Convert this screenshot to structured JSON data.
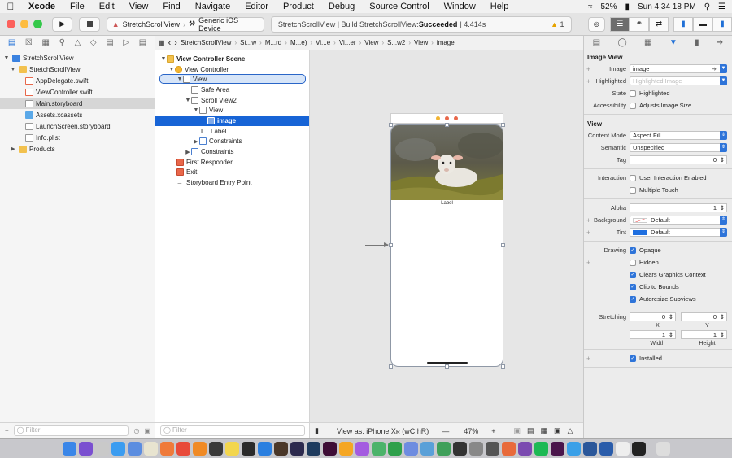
{
  "menubar": {
    "app": "Xcode",
    "items": [
      "File",
      "Edit",
      "View",
      "Find",
      "Navigate",
      "Editor",
      "Product",
      "Debug",
      "Source Control",
      "Window",
      "Help"
    ],
    "battery": "52%",
    "clock": "Sun 4 34 18 PM"
  },
  "toolbar": {
    "scheme": "StretchScrollView",
    "device": "Generic iOS Device",
    "status_prefix": "StretchScrollView | Build StretchScrollView: ",
    "status_result": "Succeeded",
    "status_time": "| 4.414s",
    "warnings": "1"
  },
  "navigator": {
    "items": [
      {
        "label": "StretchScrollView",
        "level": 0,
        "kind": "project"
      },
      {
        "label": "StretchScrollView",
        "level": 1,
        "kind": "folder"
      },
      {
        "label": "AppDelegate.swift",
        "level": 2,
        "kind": "swift"
      },
      {
        "label": "ViewController.swift",
        "level": 2,
        "kind": "swift"
      },
      {
        "label": "Main.storyboard",
        "level": 2,
        "kind": "storyboard"
      },
      {
        "label": "Assets.xcassets",
        "level": 2,
        "kind": "assets"
      },
      {
        "label": "LaunchScreen.storyboard",
        "level": 2,
        "kind": "storyboard"
      },
      {
        "label": "Info.plist",
        "level": 2,
        "kind": "plist"
      },
      {
        "label": "Products",
        "level": 1,
        "kind": "folder"
      }
    ],
    "filter_placeholder": "Filter"
  },
  "jumpbar": {
    "crumbs": [
      "StretchScrollView",
      "St...w",
      "M...rd",
      "M...e)",
      "Vi...e",
      "Vi...er",
      "View",
      "S...w2",
      "View",
      "image"
    ]
  },
  "outline": {
    "items": [
      {
        "label": "View Controller Scene",
        "level": 0
      },
      {
        "label": "View Controller",
        "level": 1
      },
      {
        "label": "View",
        "level": 2
      },
      {
        "label": "Safe Area",
        "level": 3
      },
      {
        "label": "Scroll View2",
        "level": 3
      },
      {
        "label": "View",
        "level": 4
      },
      {
        "label": "image",
        "level": 5
      },
      {
        "label": "Label",
        "level": 4
      },
      {
        "label": "Constraints",
        "level": 4
      },
      {
        "label": "Constraints",
        "level": 3
      },
      {
        "label": "First Responder",
        "level": 1
      },
      {
        "label": "Exit",
        "level": 1
      },
      {
        "label": "Storyboard Entry Point",
        "level": 1
      }
    ],
    "filter_placeholder": "Filter"
  },
  "canvas": {
    "phone_label": "Label",
    "view_as": "View as: iPhone Xʀ (wC hR)",
    "zoom": "47%"
  },
  "inspector": {
    "image_view": {
      "title": "Image View",
      "image_label": "Image",
      "image_value": "image",
      "highlighted_label": "Highlighted",
      "highlighted_placeholder": "Highlighted Image",
      "state_label": "State",
      "state_value": "Highlighted",
      "accessibility_label": "Accessibility",
      "accessibility_value": "Adjusts Image Size"
    },
    "view": {
      "title": "View",
      "content_mode_label": "Content Mode",
      "content_mode": "Aspect Fill",
      "semantic_label": "Semantic",
      "semantic": "Unspecified",
      "tag_label": "Tag",
      "tag": "0",
      "interaction_label": "Interaction",
      "user_interaction": "User Interaction Enabled",
      "multiple_touch": "Multiple Touch",
      "alpha_label": "Alpha",
      "alpha": "1",
      "background_label": "Background",
      "background": "Default",
      "tint_label": "Tint",
      "tint": "Default",
      "drawing_label": "Drawing",
      "opaque": "Opaque",
      "hidden": "Hidden",
      "clears": "Clears Graphics Context",
      "clip": "Clip to Bounds",
      "autoresize": "Autoresize Subviews",
      "stretching_label": "Stretching",
      "stretch_x": "0",
      "stretch_y": "0",
      "x_label": "X",
      "y_label": "Y",
      "stretch_w": "1",
      "stretch_h": "1",
      "width_label": "Width",
      "height_label": "Height",
      "installed": "Installed"
    }
  }
}
